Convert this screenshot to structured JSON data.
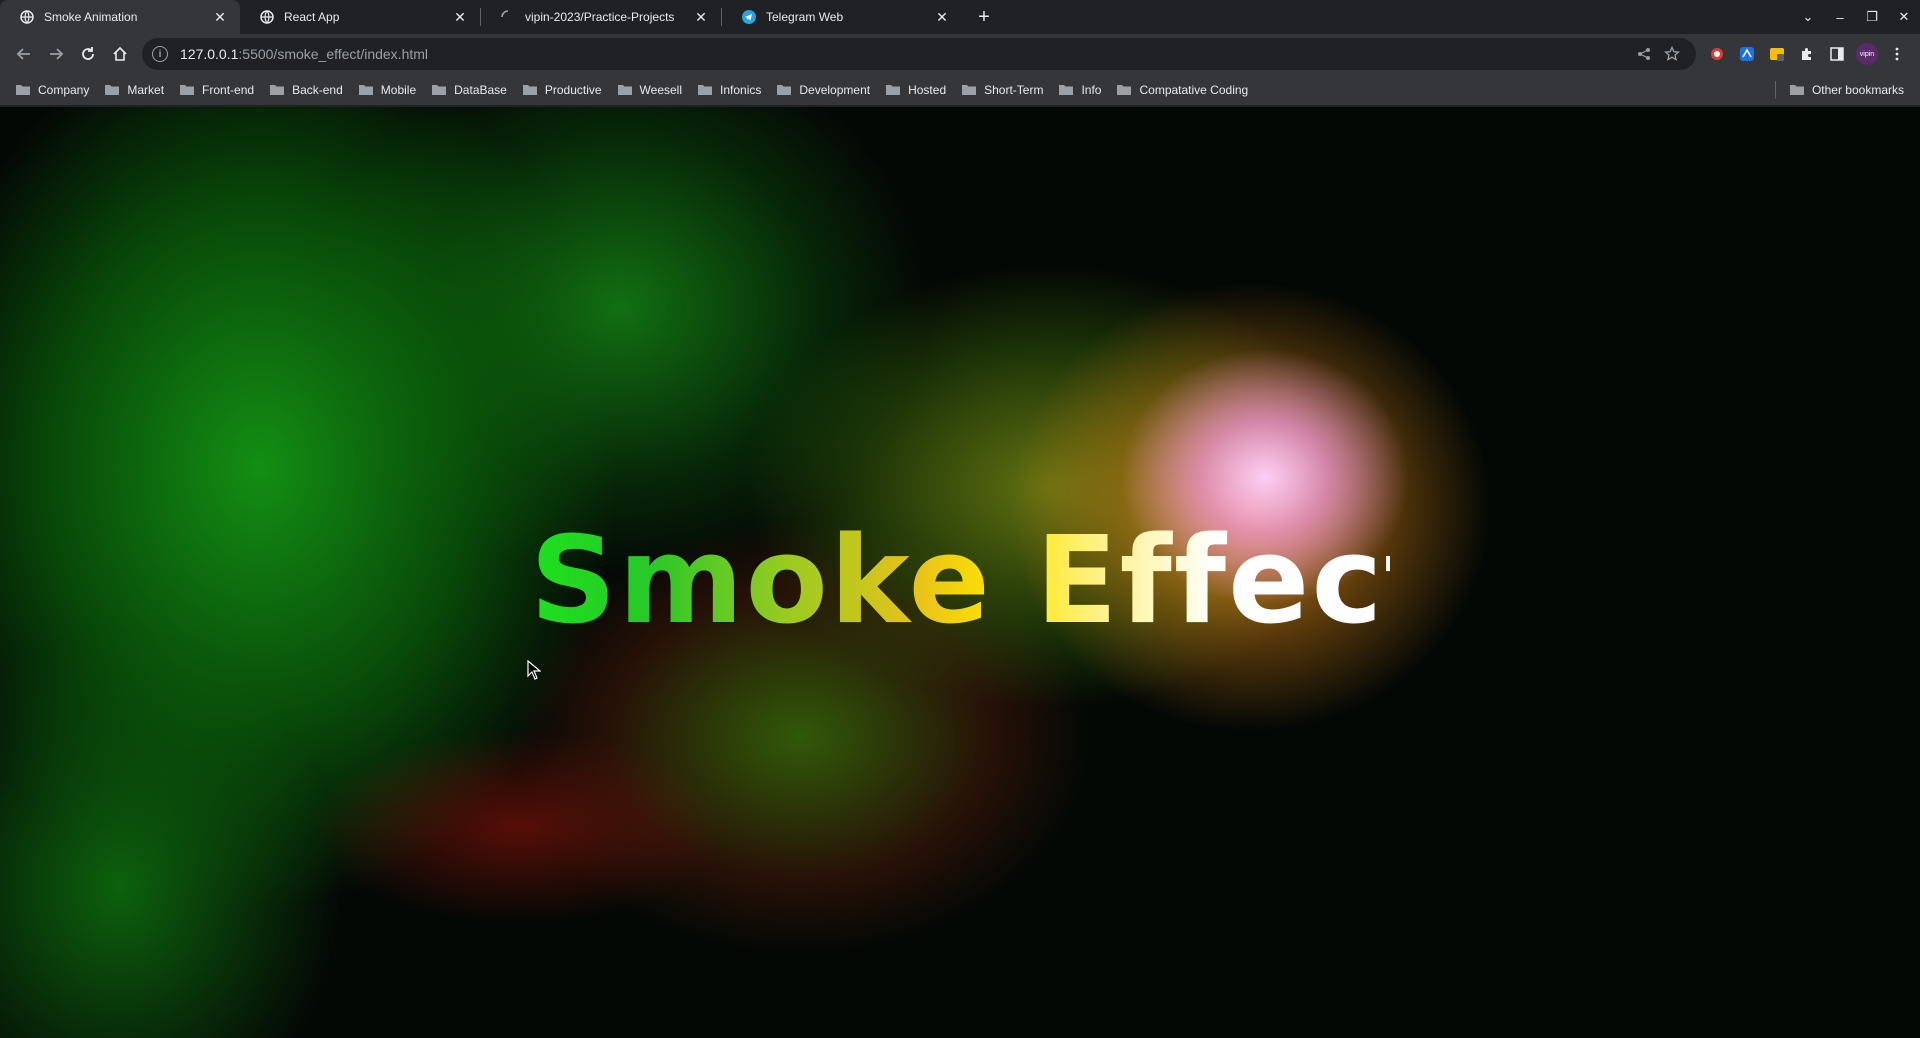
{
  "tabs": [
    {
      "title": "Smoke Animation",
      "icon": "globe-icon",
      "active": true
    },
    {
      "title": "React App",
      "icon": "globe-icon",
      "active": false
    },
    {
      "title": "vipin-2023/Practice-Projects",
      "icon": "loading-icon",
      "active": false
    },
    {
      "title": "Telegram Web",
      "icon": "telegram-icon",
      "active": false
    }
  ],
  "address": {
    "host": "127.0.0.1",
    "path": ":5500/smoke_effect/index.html"
  },
  "profile": {
    "initials": "vipin"
  },
  "bookmarks": [
    "Company",
    "Market",
    "Front-end",
    "Back-end",
    "Mobile",
    "DataBase",
    "Productive",
    "Weesell",
    "Infonics",
    "Development",
    "Hosted",
    "Short-Term",
    "Info",
    "Compatative Coding"
  ],
  "other_bookmarks": "Other bookmarks",
  "page": {
    "headline": "Smoke Effect"
  },
  "colors": {
    "chrome_dark": "#202124",
    "chrome_toolbar": "#35363a",
    "text": "#e8eaed",
    "smoke_green": "#1ee01e",
    "smoke_yellow": "#ffe600",
    "smoke_pink": "#f0a0f0"
  }
}
